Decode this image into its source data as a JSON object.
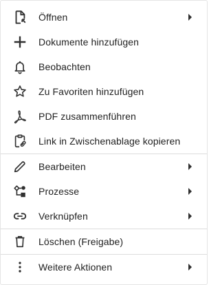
{
  "menu": {
    "items": [
      {
        "label": "Öffnen",
        "icon": "open-file-icon",
        "submenu": true
      },
      {
        "label": "Dokumente hinzufügen",
        "icon": "plus-icon",
        "submenu": false
      },
      {
        "label": "Beobachten",
        "icon": "bell-icon",
        "submenu": false
      },
      {
        "label": "Zu Favoriten hinzufügen",
        "icon": "star-outline-icon",
        "submenu": false
      },
      {
        "label": "PDF zusammenführen",
        "icon": "pdf-merge-icon",
        "submenu": false
      },
      {
        "label": "Link in Zwischenablage kopieren",
        "icon": "link-clipboard-icon",
        "submenu": false
      },
      {
        "label": "Bearbeiten",
        "icon": "pencil-icon",
        "submenu": true
      },
      {
        "label": "Prozesse",
        "icon": "process-icon",
        "submenu": true
      },
      {
        "label": "Verknüpfen",
        "icon": "link-icon",
        "submenu": true
      },
      {
        "label": "Löschen (Freigabe)",
        "icon": "trash-icon",
        "submenu": false
      },
      {
        "label": "Weitere Aktionen",
        "icon": "more-vertical-icon",
        "submenu": true
      }
    ]
  },
  "colors": {
    "text": "#212121",
    "icon": "#303030",
    "divider": "#dcdcdc",
    "background": "#ffffff"
  }
}
